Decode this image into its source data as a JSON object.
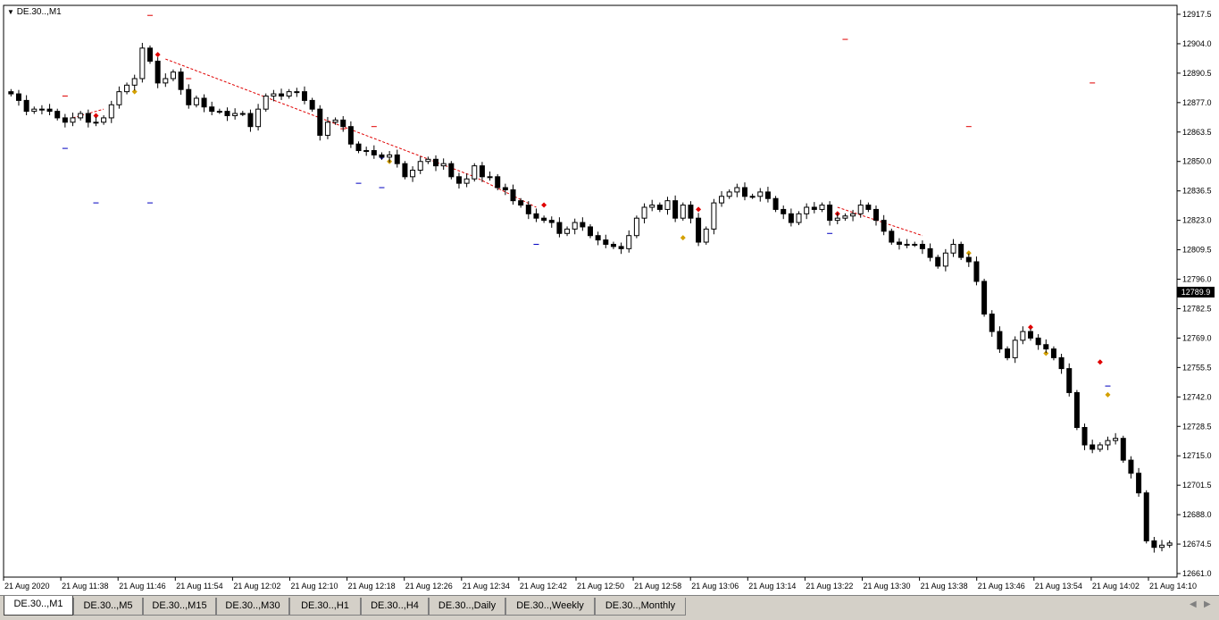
{
  "chart_title": "DE.30..,M1",
  "last_price": "12789.9",
  "tabs": [
    "DE.30..,M1",
    "DE.30..,M5",
    "DE.30..,M15",
    "DE.30..,M30",
    "DE.30..,H1",
    "DE.30..,H4",
    "DE.30..,Daily",
    "DE.30..,Weekly",
    "DE.30..,Monthly"
  ],
  "active_tab": 0,
  "colors": {
    "background": "#ffffff",
    "frame": "#000000",
    "bull_fill": "#ffffff",
    "bear_fill": "#000000",
    "resistance": "#e00000",
    "support": "#0000c0",
    "trendline": "#e00000"
  },
  "chart_data": {
    "type": "candlestick",
    "instrument": "DE.30..",
    "timeframe": "M1",
    "y_ticks": [
      "12917.5",
      "12904.0",
      "12890.5",
      "12877.0",
      "12863.5",
      "12850.0",
      "12836.5",
      "12823.0",
      "12809.5",
      "12796.0",
      "12782.5",
      "12769.0",
      "12755.5",
      "12742.0",
      "12728.5",
      "12715.0",
      "12701.5",
      "12688.0",
      "12674.5",
      "12661.0"
    ],
    "ylim": [
      12661.0,
      12917.5
    ],
    "x_ticks": [
      "21 Aug 2020",
      "21 Aug 11:38",
      "21 Aug 11:46",
      "21 Aug 11:54",
      "21 Aug 12:02",
      "21 Aug 12:10",
      "21 Aug 12:18",
      "21 Aug 12:26",
      "21 Aug 12:34",
      "21 Aug 12:42",
      "21 Aug 12:50",
      "21 Aug 12:58",
      "21 Aug 13:06",
      "21 Aug 13:14",
      "21 Aug 13:22",
      "21 Aug 13:30",
      "21 Aug 13:38",
      "21 Aug 13:46",
      "21 Aug 13:54",
      "21 Aug 14:02",
      "21 Aug 14:10"
    ],
    "closes": [
      12881,
      12878,
      12873,
      12874,
      12874,
      12873,
      12870,
      12868,
      12870,
      12872,
      12868,
      12868,
      12870,
      12876,
      12882,
      12885,
      12888,
      12902,
      12896,
      12886,
      12888,
      12891,
      12883,
      12876,
      12879,
      12875,
      12873,
      12873,
      12871,
      12872,
      12872,
      12866,
      12874,
      12880,
      12881,
      12880,
      12882,
      12882,
      12878,
      12874,
      12862,
      12868,
      12869,
      12866,
      12858,
      12855,
      12855,
      12853,
      12852,
      12853,
      12849,
      12843,
      12846,
      12850,
      12851,
      12848,
      12849,
      12843,
      12840,
      12842,
      12848,
      12843,
      12843,
      12838,
      12837,
      12832,
      12830,
      12826,
      12824,
      12823,
      12822,
      12817,
      12819,
      12822,
      12820,
      12816,
      12814,
      12812,
      12811,
      12810,
      12816,
      12824,
      12829,
      12830,
      12828,
      12832,
      12824,
      12830,
      12824,
      12813,
      12819,
      12831,
      12834,
      12836,
      12838,
      12834,
      12834,
      12836,
      12833,
      12828,
      12826,
      12822,
      12826,
      12829,
      12828,
      12830,
      12823,
      12824,
      12825,
      12826,
      12830,
      12828,
      12823,
      12818,
      12813,
      12812,
      12812,
      12812,
      12810,
      12806,
      12802,
      12808,
      12812,
      12806,
      12804,
      12795,
      12780,
      12772,
      12764,
      12760,
      12768,
      12772,
      12769,
      12766,
      12764,
      12760,
      12755,
      12744,
      12728,
      12720,
      12718,
      12720,
      12722,
      12723,
      12713,
      12707,
      12698,
      12676,
      12673,
      12674,
      12675
    ]
  }
}
